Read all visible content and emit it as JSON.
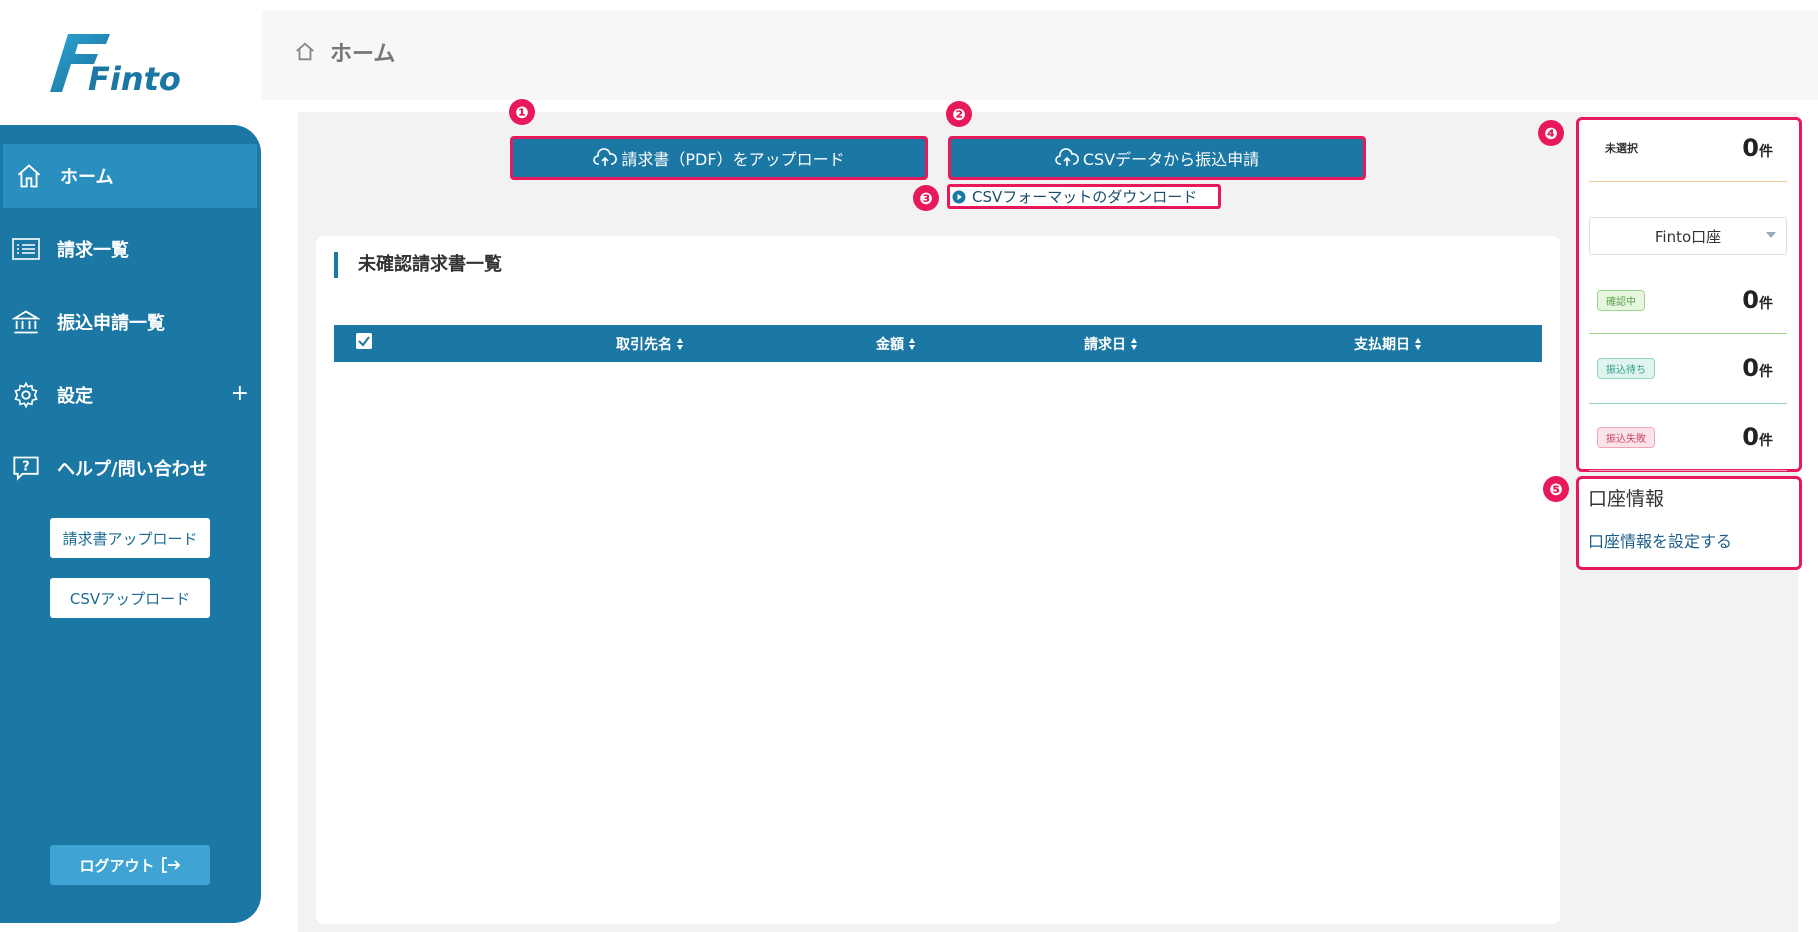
{
  "app": {
    "logo_text": "Finto",
    "brand_color": "#1b77a3",
    "highlight_color": "#e8195a"
  },
  "breadcrumb": {
    "icon": "home-icon",
    "title": "ホーム"
  },
  "sidebar": {
    "items": [
      {
        "label": "ホーム",
        "icon": "home-icon"
      },
      {
        "label": "請求一覧",
        "icon": "list-icon"
      },
      {
        "label": "振込申請一覧",
        "icon": "bank-icon"
      },
      {
        "label": "設定",
        "icon": "gear-icon",
        "expand": "+"
      },
      {
        "label": "ヘルプ/問い合わせ",
        "icon": "help-icon"
      }
    ],
    "buttons": {
      "invoice_upload": "請求書アップロード",
      "csv_upload": "CSVアップロード"
    },
    "logout": "ログアウト"
  },
  "badges": [
    "❶",
    "❷",
    "❸",
    "❹",
    "❺"
  ],
  "actions": {
    "upload_pdf": "請求書（PDF）をアップロード",
    "csv_transfer": "CSVデータから振込申請",
    "csv_format_download": "CSVフォーマットのダウンロード"
  },
  "invoices": {
    "title": "未確認請求書一覧",
    "columns": [
      "取引先名",
      "金額",
      "請求日",
      "支払期日"
    ]
  },
  "stats": {
    "unselected": {
      "label": "未選択",
      "count": "0",
      "unit": "件"
    },
    "account_select": "Finto口座",
    "confirming": {
      "label": "確認中",
      "count": "0",
      "unit": "件",
      "color": "#7cc576"
    },
    "waiting": {
      "label": "振込待ち",
      "count": "0",
      "unit": "件",
      "color": "#3bb3a3"
    },
    "failed": {
      "label": "振込失敗",
      "count": "0",
      "unit": "件",
      "color": "#e07a95"
    }
  },
  "account_info": {
    "title": "口座情報",
    "link": "口座情報を設定する"
  }
}
